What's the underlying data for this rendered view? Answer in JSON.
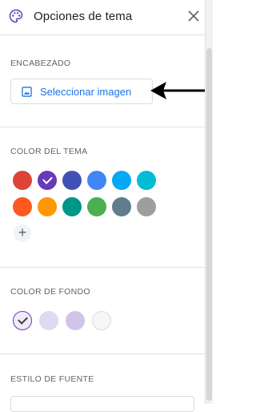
{
  "header": {
    "title": "Opciones de tema",
    "icon": "palette-icon",
    "close_icon": "close-icon"
  },
  "encabezado": {
    "label": "ENCABEZADO",
    "button_label": "Seleccionar imagen",
    "button_icon": "image-icon"
  },
  "theme_color": {
    "label": "COLOR DEL TEMA",
    "swatches": [
      "#db4437",
      "#673ab7",
      "#3f51b5",
      "#4285f4",
      "#03a9f4",
      "#00bcd4",
      "#ff5722",
      "#ff9800",
      "#009688",
      "#4caf50",
      "#607d8b",
      "#9e9e9e"
    ],
    "selected_color": "#673ab7",
    "add_label": "+"
  },
  "background_color": {
    "label": "COLOR DE FONDO",
    "swatches": [
      "#f0ebf8",
      "#e1d8f1",
      "#d1c4e9",
      "#f6f6f6"
    ],
    "selected_color": "#f0ebf8"
  },
  "font_style": {
    "label": "ESTILO DE FUENTE"
  },
  "colors": {
    "accent": "#673ab7",
    "link": "#1a73e8"
  }
}
